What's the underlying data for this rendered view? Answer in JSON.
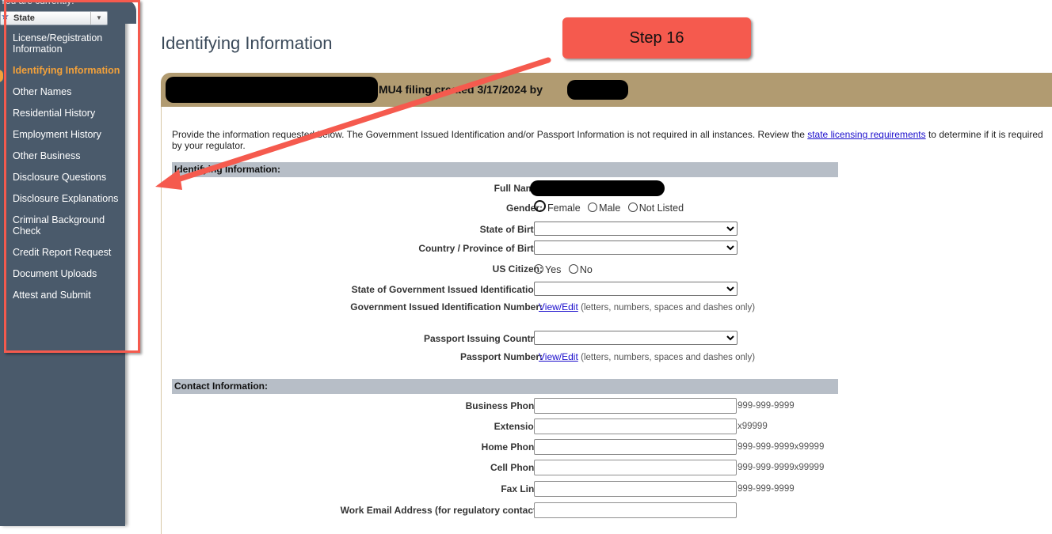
{
  "sidebar": {
    "current_label": "You are currently:",
    "state_selector": {
      "value": "State",
      "star_icon": "star-icon",
      "arrow_icon": "chevron-down-icon"
    },
    "items": [
      {
        "label": "License/Registration Information",
        "active": false
      },
      {
        "label": "Identifying Information",
        "active": true
      },
      {
        "label": "Other Names",
        "active": false
      },
      {
        "label": "Residential History",
        "active": false
      },
      {
        "label": "Employment History",
        "active": false
      },
      {
        "label": "Other Business",
        "active": false
      },
      {
        "label": "Disclosure Questions",
        "active": false
      },
      {
        "label": "Disclosure Explanations",
        "active": false
      },
      {
        "label": "Criminal Background Check",
        "active": false
      },
      {
        "label": "Credit Report Request",
        "active": false
      },
      {
        "label": "Document Uploads",
        "active": false
      },
      {
        "label": "Attest and Submit",
        "active": false
      }
    ]
  },
  "annotation": {
    "step_label": "Step 16",
    "highlight_color": "#f55a4e"
  },
  "main": {
    "title": "Identifying Information",
    "filing_bar_text": "MU4 filing created 3/17/2024 by",
    "intro_before_link": "Provide the information requested below. The Government Issued Identification and/or Passport Information is not required in all instances. Review the ",
    "intro_link": "state licensing requirements",
    "intro_after_link": " to determine if it is required by your regulator.",
    "sections": {
      "identifying": {
        "header": "Identifying Information:",
        "full_name_label": "Full Name:",
        "gender_label": "Gender:",
        "gender_options": [
          "Female",
          "Male",
          "Not Listed"
        ],
        "state_of_birth_label": "State of Birth:",
        "state_of_birth_value": "",
        "country_of_birth_label": "Country / Province of Birth:",
        "country_of_birth_value": "",
        "us_citizen_label": "US Citizen:",
        "us_citizen_options": [
          "Yes",
          "No"
        ],
        "gov_id_state_label": "State of Government Issued Identification:",
        "gov_id_state_value": "",
        "gov_id_number_label": "Government Issued Identification Number:",
        "view_edit_label": "View/Edit",
        "id_hint": "(letters, numbers, spaces and dashes only)",
        "passport_country_label": "Passport Issuing Country:",
        "passport_country_value": "",
        "passport_number_label": "Passport Number:"
      },
      "contact": {
        "header": "Contact Information:",
        "fields": [
          {
            "label": "Business Phone:",
            "value": "",
            "hint": "999-999-9999"
          },
          {
            "label": "Extension:",
            "value": "",
            "hint": "x99999"
          },
          {
            "label": "Home Phone:",
            "value": "",
            "hint": "999-999-9999x99999"
          },
          {
            "label": "Cell Phone:",
            "value": "",
            "hint": "999-999-9999x99999"
          },
          {
            "label": "Fax Line:",
            "value": "",
            "hint": "999-999-9999"
          },
          {
            "label": "Work Email Address (for regulatory contact):",
            "value": "",
            "hint": ""
          }
        ]
      }
    }
  },
  "colors": {
    "sidebar_bg": "#4a5a6b",
    "active_nav": "#f3a13a",
    "filing_bar": "#b19b71",
    "section_header": "#b7bec7",
    "link": "#1a0dcc"
  }
}
